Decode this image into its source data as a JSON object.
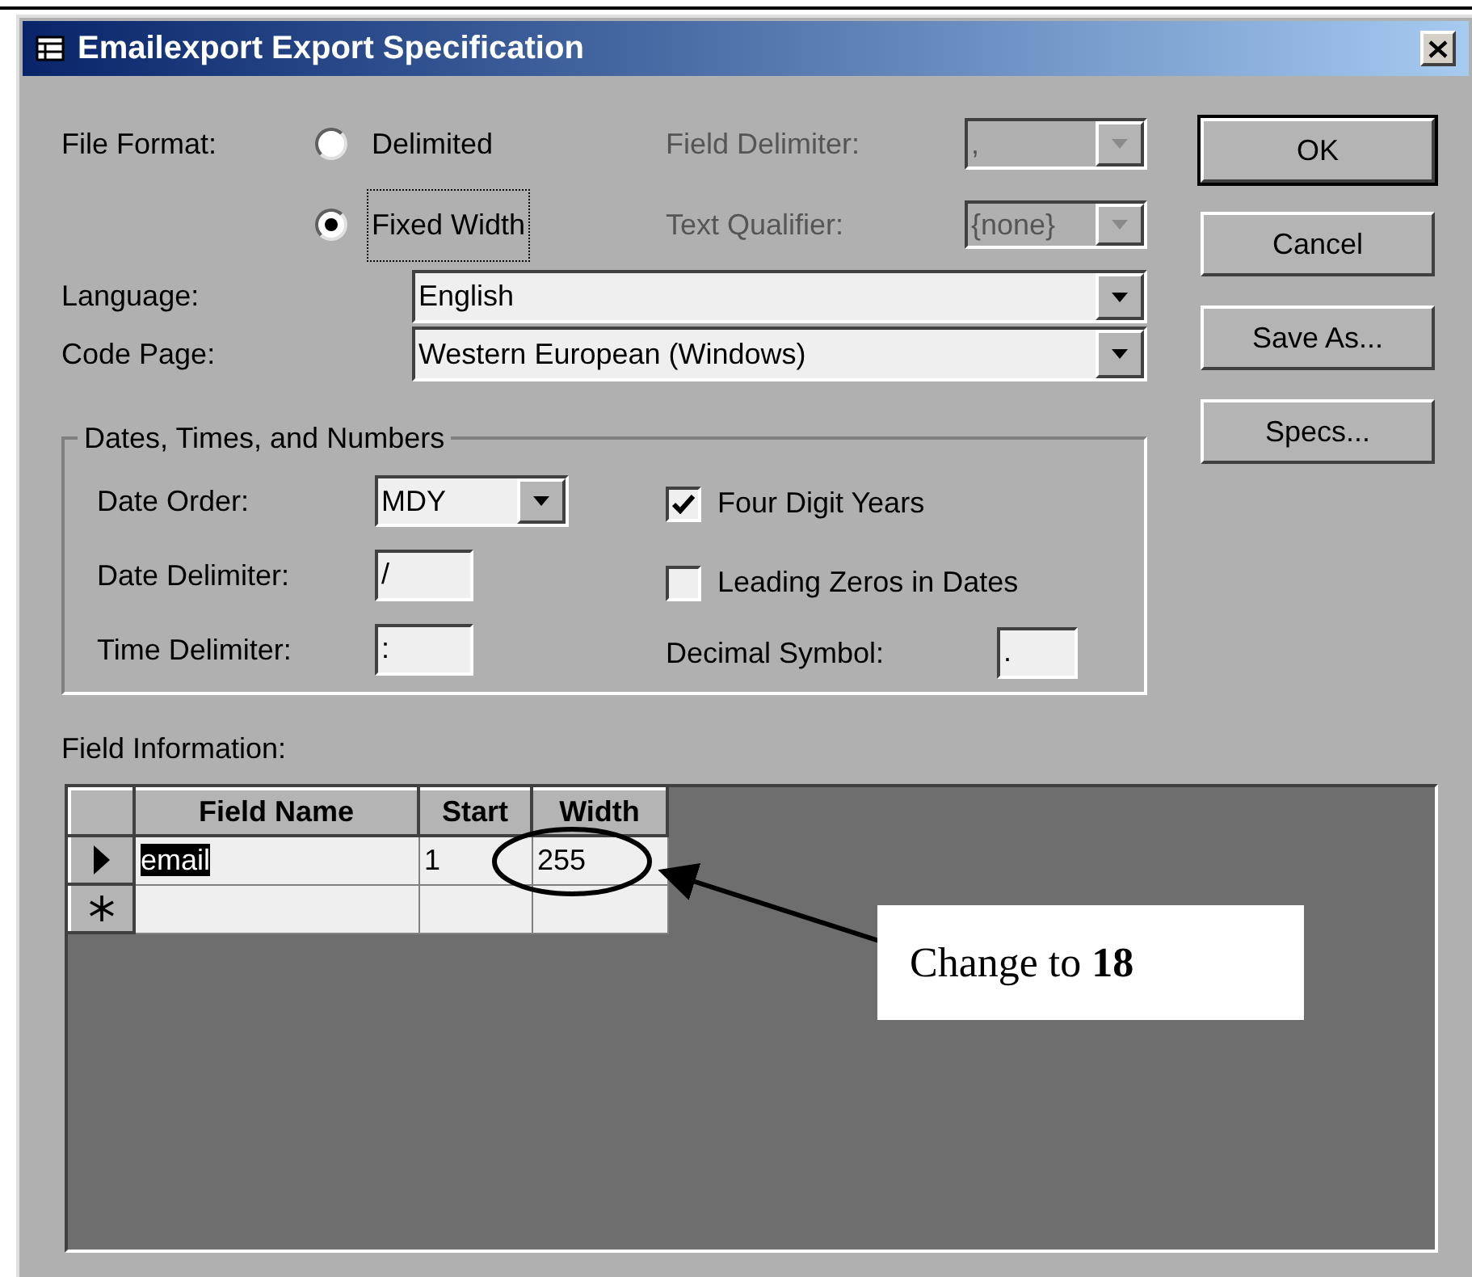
{
  "window": {
    "title": "Emailexport Export Specification"
  },
  "file_format": {
    "label": "File Format:",
    "options": [
      {
        "label": "Delimited",
        "selected": false
      },
      {
        "label": "Fixed Width",
        "selected": true
      }
    ]
  },
  "field_delimiter": {
    "label": "Field Delimiter:",
    "value": ",",
    "disabled": true
  },
  "text_qualifier": {
    "label": "Text Qualifier:",
    "value": "{none}",
    "disabled": true
  },
  "language": {
    "label": "Language:",
    "value": "English"
  },
  "code_page": {
    "label": "Code Page:",
    "value": "Western European (Windows)"
  },
  "buttons": [
    {
      "label": "OK",
      "default": true
    },
    {
      "label": "Cancel",
      "default": false
    },
    {
      "label": "Save As...",
      "default": false
    },
    {
      "label": "Specs...",
      "default": false
    }
  ],
  "dates_group": {
    "title": "Dates, Times, and Numbers",
    "date_order": {
      "label": "Date Order:",
      "value": "MDY"
    },
    "date_delimiter": {
      "label": "Date Delimiter:",
      "value": "/"
    },
    "time_delimiter": {
      "label": "Time Delimiter:",
      "value": ":"
    },
    "four_digit_years": {
      "label": "Four Digit Years",
      "checked": true
    },
    "leading_zeros": {
      "label": "Leading Zeros in Dates",
      "checked": false
    },
    "decimal_symbol": {
      "label": "Decimal Symbol:",
      "value": "."
    }
  },
  "field_information": {
    "label": "Field Information:",
    "columns": [
      "Field Name",
      "Start",
      "Width"
    ],
    "rows": [
      {
        "kind": "current",
        "cells": [
          {
            "text": "email",
            "selected": true
          },
          {
            "text": "1",
            "selected": false
          },
          {
            "text": "255",
            "selected": false
          }
        ]
      },
      {
        "kind": "new",
        "cells": []
      }
    ]
  },
  "annotation": {
    "text": "Change to **18**"
  }
}
